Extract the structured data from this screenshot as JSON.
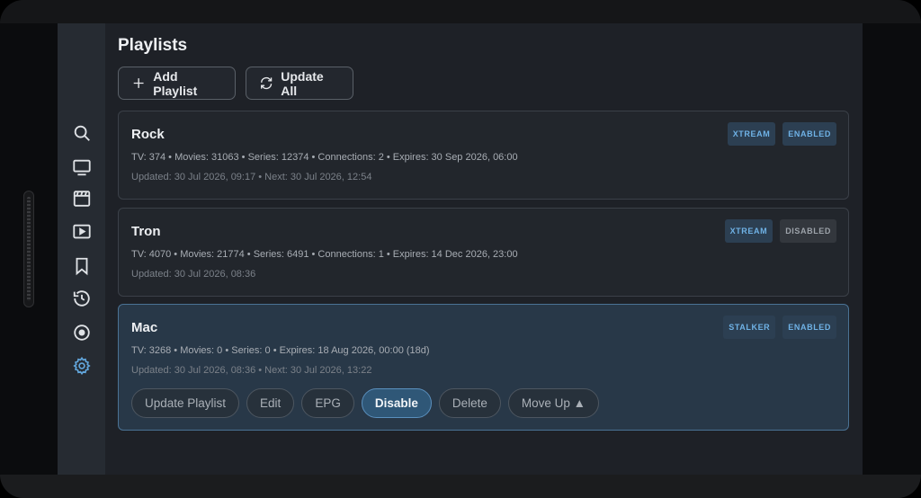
{
  "page": {
    "title": "Playlists"
  },
  "toolbar": {
    "add_label": "Add Playlist",
    "update_all_label": "Update All"
  },
  "sidebar": {
    "items": [
      {
        "name": "search",
        "icon": "search-icon"
      },
      {
        "name": "live-tv",
        "icon": "tv-icon"
      },
      {
        "name": "movies",
        "icon": "film-icon"
      },
      {
        "name": "series",
        "icon": "play-box-icon"
      },
      {
        "name": "bookmarks",
        "icon": "bookmark-icon"
      },
      {
        "name": "history",
        "icon": "history-icon"
      },
      {
        "name": "record",
        "icon": "record-icon"
      },
      {
        "name": "settings",
        "icon": "gear-icon",
        "active": true
      }
    ]
  },
  "playlists": [
    {
      "name": "Rock",
      "type_badge": "XTREAM",
      "status_badge": "ENABLED",
      "details": "TV: 374  •  Movies: 31063  •  Series: 12374  •  Connections: 2  •  Expires: 30 Sep 2026, 06:00",
      "updated": "Updated: 30 Jul 2026, 09:17  •  Next: 30 Jul 2026, 12:54"
    },
    {
      "name": "Tron",
      "type_badge": "XTREAM",
      "status_badge": "DISABLED",
      "details": "TV: 4070  •  Movies: 21774  •  Series: 6491  •  Connections: 1  •  Expires: 14 Dec 2026, 23:00",
      "updated": "Updated: 30 Jul 2026, 08:36"
    },
    {
      "name": "Mac",
      "type_badge": "STALKER",
      "status_badge": "ENABLED",
      "details": "TV: 3268  •  Movies: 0  •  Series: 0  •  Expires: 18 Aug 2026, 00:00 (18d)",
      "updated": "Updated: 30 Jul 2026, 08:36  •  Next: 30 Jul 2026, 13:22",
      "actions": {
        "update": "Update Playlist",
        "edit": "Edit",
        "epg": "EPG",
        "disable": "Disable",
        "delete": "Delete",
        "move_up": "Move Up ▲"
      }
    }
  ],
  "colors": {
    "accent": "#6fb2e6",
    "selected_card": "#283848",
    "active_pill": "#2f5777"
  }
}
